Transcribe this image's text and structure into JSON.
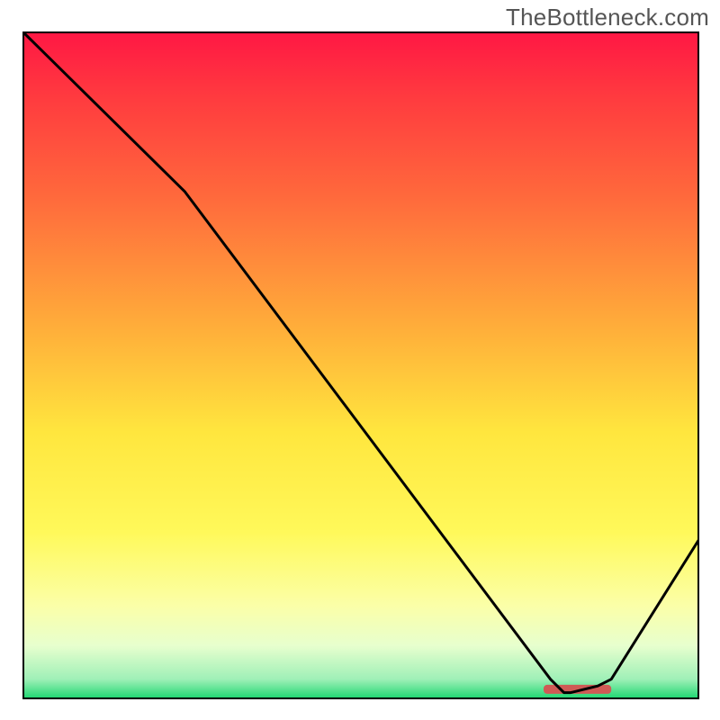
{
  "watermark": "TheBottleneck.com",
  "chart_data": {
    "type": "line",
    "title": "",
    "xlabel": "",
    "ylabel": "",
    "xlim": [
      0,
      100
    ],
    "ylim": [
      0,
      100
    ],
    "series": [
      {
        "name": "curve",
        "x": [
          0,
          24,
          78,
          80,
          81,
          85,
          87,
          100
        ],
        "values": [
          100,
          76,
          3,
          1,
          1,
          2,
          3,
          24
        ]
      }
    ],
    "minimum_marker": {
      "x_start": 77,
      "x_end": 87,
      "y": 1.5,
      "color": "#cf5a55"
    },
    "background_gradient_stops": [
      {
        "pct": 0,
        "color": "#ff1744"
      },
      {
        "pct": 10,
        "color": "#ff3b3f"
      },
      {
        "pct": 25,
        "color": "#ff6a3c"
      },
      {
        "pct": 45,
        "color": "#ffb03a"
      },
      {
        "pct": 60,
        "color": "#ffe63e"
      },
      {
        "pct": 75,
        "color": "#fff95a"
      },
      {
        "pct": 86,
        "color": "#fbffa8"
      },
      {
        "pct": 92,
        "color": "#e7ffce"
      },
      {
        "pct": 97,
        "color": "#9ff0b7"
      },
      {
        "pct": 100,
        "color": "#18d66e"
      }
    ],
    "axis_frame_color": "#000000",
    "line_color": "#000000"
  }
}
